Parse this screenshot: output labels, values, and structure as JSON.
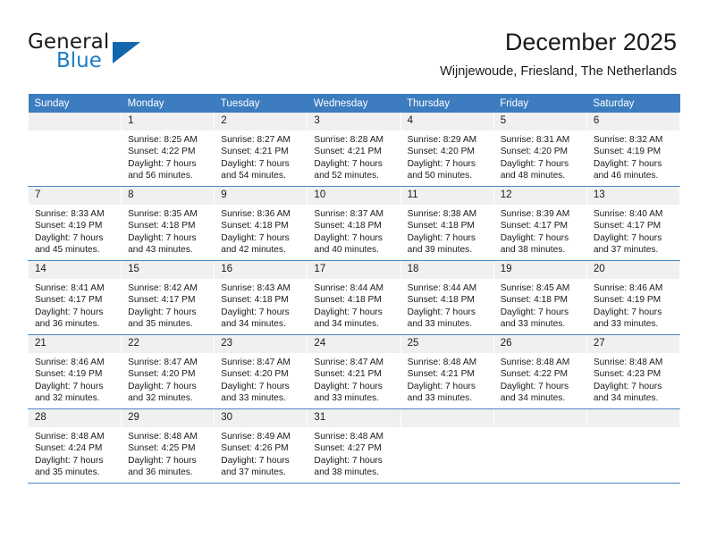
{
  "brand": {
    "name_part1": "General",
    "name_part2": "Blue",
    "triangle_color": "#1267ad",
    "blue_text_color": "#1d7dc4"
  },
  "header": {
    "title": "December 2025",
    "subtitle": "Wijnjewoude, Friesland, The Netherlands",
    "accent_color": "#3c7cbf"
  },
  "calendar": {
    "weekday_headers": [
      "Sunday",
      "Monday",
      "Tuesday",
      "Wednesday",
      "Thursday",
      "Friday",
      "Saturday"
    ],
    "weeks": [
      [
        {
          "day": "",
          "empty": true,
          "sunrise": "",
          "sunset": "",
          "daylight1": "",
          "daylight2": ""
        },
        {
          "day": "1",
          "sunrise": "Sunrise: 8:25 AM",
          "sunset": "Sunset: 4:22 PM",
          "daylight1": "Daylight: 7 hours",
          "daylight2": "and 56 minutes."
        },
        {
          "day": "2",
          "sunrise": "Sunrise: 8:27 AM",
          "sunset": "Sunset: 4:21 PM",
          "daylight1": "Daylight: 7 hours",
          "daylight2": "and 54 minutes."
        },
        {
          "day": "3",
          "sunrise": "Sunrise: 8:28 AM",
          "sunset": "Sunset: 4:21 PM",
          "daylight1": "Daylight: 7 hours",
          "daylight2": "and 52 minutes."
        },
        {
          "day": "4",
          "sunrise": "Sunrise: 8:29 AM",
          "sunset": "Sunset: 4:20 PM",
          "daylight1": "Daylight: 7 hours",
          "daylight2": "and 50 minutes."
        },
        {
          "day": "5",
          "sunrise": "Sunrise: 8:31 AM",
          "sunset": "Sunset: 4:20 PM",
          "daylight1": "Daylight: 7 hours",
          "daylight2": "and 48 minutes."
        },
        {
          "day": "6",
          "sunrise": "Sunrise: 8:32 AM",
          "sunset": "Sunset: 4:19 PM",
          "daylight1": "Daylight: 7 hours",
          "daylight2": "and 46 minutes."
        }
      ],
      [
        {
          "day": "7",
          "sunrise": "Sunrise: 8:33 AM",
          "sunset": "Sunset: 4:19 PM",
          "daylight1": "Daylight: 7 hours",
          "daylight2": "and 45 minutes."
        },
        {
          "day": "8",
          "sunrise": "Sunrise: 8:35 AM",
          "sunset": "Sunset: 4:18 PM",
          "daylight1": "Daylight: 7 hours",
          "daylight2": "and 43 minutes."
        },
        {
          "day": "9",
          "sunrise": "Sunrise: 8:36 AM",
          "sunset": "Sunset: 4:18 PM",
          "daylight1": "Daylight: 7 hours",
          "daylight2": "and 42 minutes."
        },
        {
          "day": "10",
          "sunrise": "Sunrise: 8:37 AM",
          "sunset": "Sunset: 4:18 PM",
          "daylight1": "Daylight: 7 hours",
          "daylight2": "and 40 minutes."
        },
        {
          "day": "11",
          "sunrise": "Sunrise: 8:38 AM",
          "sunset": "Sunset: 4:18 PM",
          "daylight1": "Daylight: 7 hours",
          "daylight2": "and 39 minutes."
        },
        {
          "day": "12",
          "sunrise": "Sunrise: 8:39 AM",
          "sunset": "Sunset: 4:17 PM",
          "daylight1": "Daylight: 7 hours",
          "daylight2": "and 38 minutes."
        },
        {
          "day": "13",
          "sunrise": "Sunrise: 8:40 AM",
          "sunset": "Sunset: 4:17 PM",
          "daylight1": "Daylight: 7 hours",
          "daylight2": "and 37 minutes."
        }
      ],
      [
        {
          "day": "14",
          "sunrise": "Sunrise: 8:41 AM",
          "sunset": "Sunset: 4:17 PM",
          "daylight1": "Daylight: 7 hours",
          "daylight2": "and 36 minutes."
        },
        {
          "day": "15",
          "sunrise": "Sunrise: 8:42 AM",
          "sunset": "Sunset: 4:17 PM",
          "daylight1": "Daylight: 7 hours",
          "daylight2": "and 35 minutes."
        },
        {
          "day": "16",
          "sunrise": "Sunrise: 8:43 AM",
          "sunset": "Sunset: 4:18 PM",
          "daylight1": "Daylight: 7 hours",
          "daylight2": "and 34 minutes."
        },
        {
          "day": "17",
          "sunrise": "Sunrise: 8:44 AM",
          "sunset": "Sunset: 4:18 PM",
          "daylight1": "Daylight: 7 hours",
          "daylight2": "and 34 minutes."
        },
        {
          "day": "18",
          "sunrise": "Sunrise: 8:44 AM",
          "sunset": "Sunset: 4:18 PM",
          "daylight1": "Daylight: 7 hours",
          "daylight2": "and 33 minutes."
        },
        {
          "day": "19",
          "sunrise": "Sunrise: 8:45 AM",
          "sunset": "Sunset: 4:18 PM",
          "daylight1": "Daylight: 7 hours",
          "daylight2": "and 33 minutes."
        },
        {
          "day": "20",
          "sunrise": "Sunrise: 8:46 AM",
          "sunset": "Sunset: 4:19 PM",
          "daylight1": "Daylight: 7 hours",
          "daylight2": "and 33 minutes."
        }
      ],
      [
        {
          "day": "21",
          "sunrise": "Sunrise: 8:46 AM",
          "sunset": "Sunset: 4:19 PM",
          "daylight1": "Daylight: 7 hours",
          "daylight2": "and 32 minutes."
        },
        {
          "day": "22",
          "sunrise": "Sunrise: 8:47 AM",
          "sunset": "Sunset: 4:20 PM",
          "daylight1": "Daylight: 7 hours",
          "daylight2": "and 32 minutes."
        },
        {
          "day": "23",
          "sunrise": "Sunrise: 8:47 AM",
          "sunset": "Sunset: 4:20 PM",
          "daylight1": "Daylight: 7 hours",
          "daylight2": "and 33 minutes."
        },
        {
          "day": "24",
          "sunrise": "Sunrise: 8:47 AM",
          "sunset": "Sunset: 4:21 PM",
          "daylight1": "Daylight: 7 hours",
          "daylight2": "and 33 minutes."
        },
        {
          "day": "25",
          "sunrise": "Sunrise: 8:48 AM",
          "sunset": "Sunset: 4:21 PM",
          "daylight1": "Daylight: 7 hours",
          "daylight2": "and 33 minutes."
        },
        {
          "day": "26",
          "sunrise": "Sunrise: 8:48 AM",
          "sunset": "Sunset: 4:22 PM",
          "daylight1": "Daylight: 7 hours",
          "daylight2": "and 34 minutes."
        },
        {
          "day": "27",
          "sunrise": "Sunrise: 8:48 AM",
          "sunset": "Sunset: 4:23 PM",
          "daylight1": "Daylight: 7 hours",
          "daylight2": "and 34 minutes."
        }
      ],
      [
        {
          "day": "28",
          "sunrise": "Sunrise: 8:48 AM",
          "sunset": "Sunset: 4:24 PM",
          "daylight1": "Daylight: 7 hours",
          "daylight2": "and 35 minutes."
        },
        {
          "day": "29",
          "sunrise": "Sunrise: 8:48 AM",
          "sunset": "Sunset: 4:25 PM",
          "daylight1": "Daylight: 7 hours",
          "daylight2": "and 36 minutes."
        },
        {
          "day": "30",
          "sunrise": "Sunrise: 8:49 AM",
          "sunset": "Sunset: 4:26 PM",
          "daylight1": "Daylight: 7 hours",
          "daylight2": "and 37 minutes."
        },
        {
          "day": "31",
          "sunrise": "Sunrise: 8:48 AM",
          "sunset": "Sunset: 4:27 PM",
          "daylight1": "Daylight: 7 hours",
          "daylight2": "and 38 minutes."
        },
        {
          "day": "",
          "empty": true,
          "sunrise": "",
          "sunset": "",
          "daylight1": "",
          "daylight2": ""
        },
        {
          "day": "",
          "empty": true,
          "sunrise": "",
          "sunset": "",
          "daylight1": "",
          "daylight2": ""
        },
        {
          "day": "",
          "empty": true,
          "sunrise": "",
          "sunset": "",
          "daylight1": "",
          "daylight2": ""
        }
      ]
    ]
  }
}
